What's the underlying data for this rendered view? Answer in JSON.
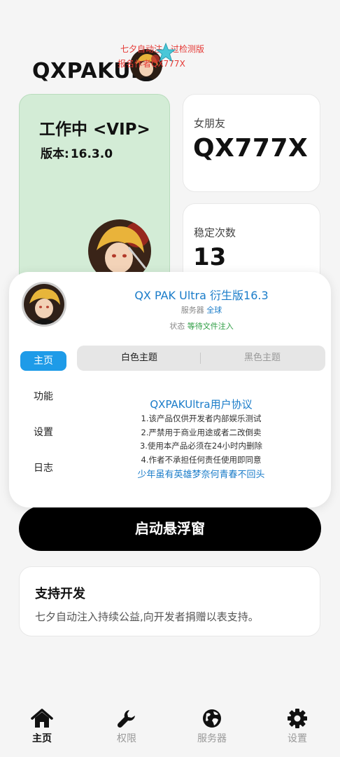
{
  "app": {
    "title": "QXPAKUlt",
    "watermark_line1": "七夕自动注入过检测版",
    "watermark_line2": "报名作者QX777X"
  },
  "status_card": {
    "status_text": "工作中 <VIP>",
    "version_label": "版本:",
    "version_value": "16.3.0"
  },
  "girlfriend_card": {
    "label": "女朋友",
    "value": "QX777X"
  },
  "stability_card": {
    "label": "稳定次数",
    "value": "13"
  },
  "panel": {
    "title": "QX PAK Ultra 衍生版16.3",
    "server_label": "服务器",
    "server_value": "全球",
    "state_label": "状态",
    "state_value": "等待文件注入",
    "nav": [
      {
        "label": "主页",
        "active": true
      },
      {
        "label": "功能",
        "active": false
      },
      {
        "label": "设置",
        "active": false
      },
      {
        "label": "日志",
        "active": false
      }
    ],
    "theme_light": "白色主题",
    "theme_dark": "黑色主题",
    "agreement_title": "QXPAKUltra用户协议",
    "agreement_lines": [
      "1.该产品仅供开发者内部娱乐测试",
      "2.严禁用于商业用途或者二改倒卖",
      "3.使用本产品必须在24小时内删除",
      "4.作者不承担任何责任使用即同意"
    ],
    "motto": "少年虽有英雄梦奈何青春不回头"
  },
  "launch_button": "启动悬浮窗",
  "support": {
    "title": "支持开发",
    "desc": "七夕自动注入持续公益,向开发者捐赠以表支持。"
  },
  "bottom_nav": [
    {
      "label": "主页",
      "icon": "home-icon",
      "active": true
    },
    {
      "label": "权限",
      "icon": "wrench-icon",
      "active": false
    },
    {
      "label": "服务器",
      "icon": "globe-icon",
      "active": false
    },
    {
      "label": "设置",
      "icon": "gear-icon",
      "active": false
    }
  ],
  "colors": {
    "accent_blue": "#1a7cc9",
    "nav_active": "#1e9be8",
    "status_green": "#2e9e44",
    "status_card_bg": "#d3ecd6",
    "watermark_red": "#e53935"
  }
}
